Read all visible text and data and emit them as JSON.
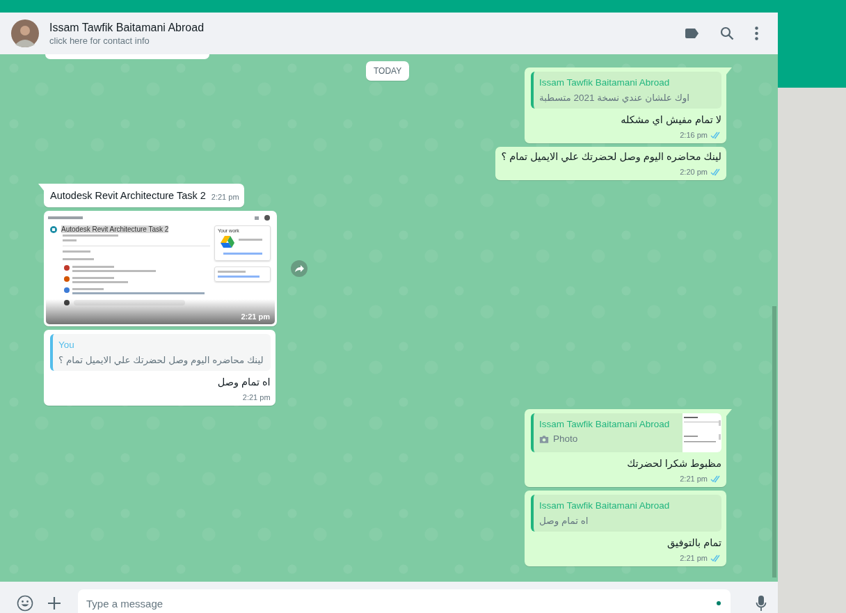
{
  "header": {
    "name": "Issam Tawfik Baitamani Abroad",
    "subtitle": "click here for contact info"
  },
  "date_chip": "TODAY",
  "messages": [
    {
      "kind": "cut",
      "outgoing": false
    },
    {
      "kind": "text",
      "outgoing": true,
      "tail": true,
      "quote": {
        "kind": "text",
        "author": "Issam Tawfik Baitamani Abroad",
        "color": "#21b57f",
        "text": "اوك علشان عندي نسخة 2021 متسطبة"
      },
      "text": "لا تمام مفيش اي مشكله",
      "time": "2:16 pm",
      "read": true
    },
    {
      "kind": "text",
      "outgoing": true,
      "tail": false,
      "text": "لينك محاضره اليوم وصل لحضرتك علي الايميل تمام ؟",
      "time": "2:20 pm",
      "read": true
    },
    {
      "kind": "inline",
      "outgoing": false,
      "tail": true,
      "text": "Autodesk Revit Architecture Task 2",
      "time": "2:21 pm"
    },
    {
      "kind": "image",
      "outgoing": false,
      "tail": false,
      "title": "Autodesk Revit Architecture Task 2",
      "side_title": "Your work",
      "time": "2:21 pm"
    },
    {
      "kind": "text",
      "outgoing": false,
      "tail": false,
      "quote": {
        "kind": "text",
        "author": "You",
        "color": "#53bdeb",
        "text": "لينك محاضره اليوم وصل لحضرتك علي الايميل تمام ؟"
      },
      "text": "اه تمام وصل",
      "time": "2:21 pm"
    },
    {
      "kind": "text",
      "outgoing": true,
      "tail": true,
      "quote": {
        "kind": "photo",
        "author": "Issam Tawfik Baitamani Abroad",
        "color": "#21b57f",
        "text": "Photo"
      },
      "text": "مظبوط شكرا لحضرتك",
      "time": "2:21 pm",
      "read": true
    },
    {
      "kind": "text",
      "outgoing": true,
      "tail": false,
      "quote": {
        "kind": "text",
        "author": "Issam Tawfik Baitamani Abroad",
        "color": "#21b57f",
        "text": "اه تمام وصل"
      },
      "text": "تمام بالتوفيق",
      "time": "2:21 pm",
      "read": true
    }
  ],
  "composer": {
    "placeholder": "Type a message"
  }
}
